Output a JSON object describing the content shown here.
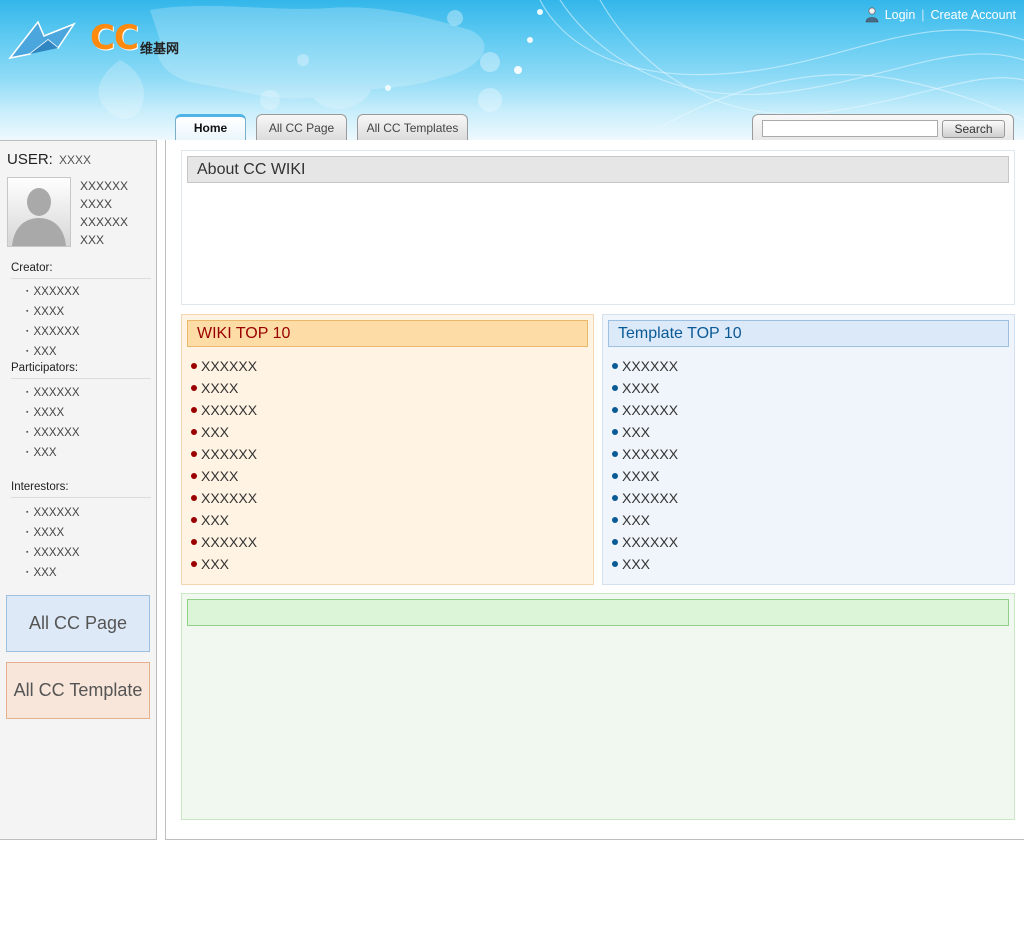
{
  "header": {
    "logo_text": "CC",
    "logo_subtitle": "维基网",
    "login_label": "Login",
    "separator": "|",
    "create_account_label": "Create Account"
  },
  "tabs": [
    {
      "label": "Home",
      "active": true
    },
    {
      "label": "All CC Page",
      "active": false
    },
    {
      "label": "All CC Templates",
      "active": false
    }
  ],
  "search": {
    "placeholder": "",
    "button_label": "Search"
  },
  "sidebar": {
    "user_label": "USER:",
    "user_name": "XXXX",
    "user_info": [
      "XXXXXX",
      "XXXX",
      "XXXXXX",
      "XXX"
    ],
    "creator_title": "Creator:",
    "creators": [
      "XXXXXX",
      "XXXX",
      "XXXXXX",
      "XXX"
    ],
    "participators_title": "Participators:",
    "participators": [
      "XXXXXX",
      "XXXX",
      "XXXXXX",
      "XXX"
    ],
    "interestors_title": "Interestors:",
    "interestors": [
      "XXXXXX",
      "XXXX",
      "XXXXXX",
      "XXX"
    ],
    "all_page_button": "All CC Page",
    "all_template_button": "All CC Template"
  },
  "main": {
    "about_title": "About CC WIKI",
    "wiki_top_title": "WIKI TOP 10",
    "wiki_top": [
      "XXXXXX",
      "XXXX",
      "XXXXXX",
      "XXX",
      "XXXXXX",
      "XXXX",
      "XXXXXX",
      "XXX",
      "XXXXXX",
      "XXX"
    ],
    "template_top_title": "Template TOP 10",
    "template_top": [
      "XXXXXX",
      "XXXX",
      "XXXXXX",
      "XXX",
      "XXXXXX",
      "XXXX",
      "XXXXXX",
      "XXX",
      "XXXXXX",
      "XXX"
    ],
    "bottom_panel_title": ""
  },
  "colors": {
    "wiki_accent": "#990000",
    "template_accent": "#0a5a96",
    "header_sky": "#33b6ea",
    "logo_orange": "#ff8a10"
  },
  "icons": {
    "logo": "paper-plane-arrows-icon",
    "login": "user-icon",
    "avatar": "person-silhouette-icon"
  }
}
